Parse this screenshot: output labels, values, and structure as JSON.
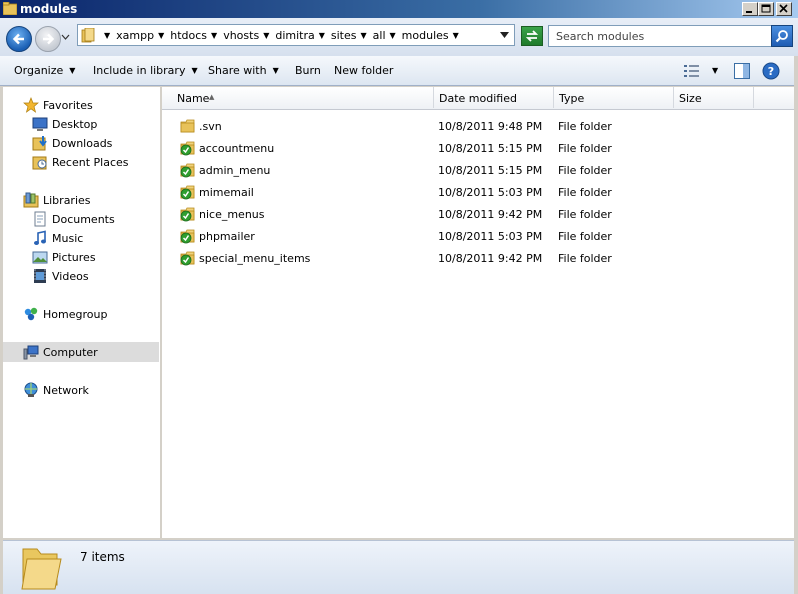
{
  "window": {
    "title": "modules"
  },
  "address": {
    "crumbs": [
      "xampp",
      "htdocs",
      "vhosts",
      "dimitra",
      "sites",
      "all",
      "modules"
    ]
  },
  "search": {
    "placeholder": "Search modules"
  },
  "toolbar": {
    "organize": "Organize",
    "include_in_library": "Include in library",
    "share_with": "Share with",
    "burn": "Burn",
    "new_folder": "New folder"
  },
  "nav": {
    "favorites": {
      "label": "Favorites",
      "items": [
        "Desktop",
        "Downloads",
        "Recent Places"
      ]
    },
    "libraries": {
      "label": "Libraries",
      "items": [
        "Documents",
        "Music",
        "Pictures",
        "Videos"
      ]
    },
    "homegroup": "Homegroup",
    "computer": "Computer",
    "network": "Network"
  },
  "columns": [
    "Name",
    "Date modified",
    "Type",
    "Size"
  ],
  "files": [
    {
      "name": ".svn",
      "date": "10/8/2011 9:48 PM",
      "type": "File folder",
      "icon": "folder-icon"
    },
    {
      "name": "accountmenu",
      "date": "10/8/2011 5:15 PM",
      "type": "File folder",
      "icon": "svn-folder-icon"
    },
    {
      "name": "admin_menu",
      "date": "10/8/2011 5:15 PM",
      "type": "File folder",
      "icon": "svn-folder-icon"
    },
    {
      "name": "mimemail",
      "date": "10/8/2011 5:03 PM",
      "type": "File folder",
      "icon": "svn-folder-icon"
    },
    {
      "name": "nice_menus",
      "date": "10/8/2011 9:42 PM",
      "type": "File folder",
      "icon": "svn-folder-icon"
    },
    {
      "name": "phpmailer",
      "date": "10/8/2011 5:03 PM",
      "type": "File folder",
      "icon": "svn-folder-icon"
    },
    {
      "name": "special_menu_items",
      "date": "10/8/2011 9:42 PM",
      "type": "File folder",
      "icon": "svn-folder-icon"
    }
  ],
  "details": {
    "count": "7 items"
  },
  "colors": {
    "titlebar": "#0a246a",
    "nav_selected": "#dcdcdc",
    "svn_badge": "#2f9e2f"
  }
}
